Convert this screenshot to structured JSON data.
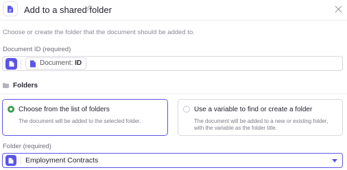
{
  "header": {
    "title": "Add to a shared folder"
  },
  "description": "Choose or create the folder that the document should be added to.",
  "document_id": {
    "label": "Document ID (required)",
    "chip_prefix": "Document:",
    "chip_value": "ID"
  },
  "folders": {
    "section_label": "Folders",
    "options": [
      {
        "title": "Choose from the list of folders",
        "description": "The document will be added to the selected folder.",
        "selected": true
      },
      {
        "title": "Use a variable to find or create a folder",
        "description": "The document will be added to a new or existing folder, with the variable as the folder title.",
        "selected": false
      }
    ]
  },
  "folder_select": {
    "label": "Folder (required)",
    "value": "Employment Contracts"
  },
  "colors": {
    "accent": "#5b54e6",
    "radio_selected": "#3f9a4b"
  },
  "icons": {
    "app": "document-icon",
    "edit": "pencil-icon",
    "close": "close-icon",
    "folder": "folder-icon",
    "dropdown": "chevron-down-icon"
  }
}
